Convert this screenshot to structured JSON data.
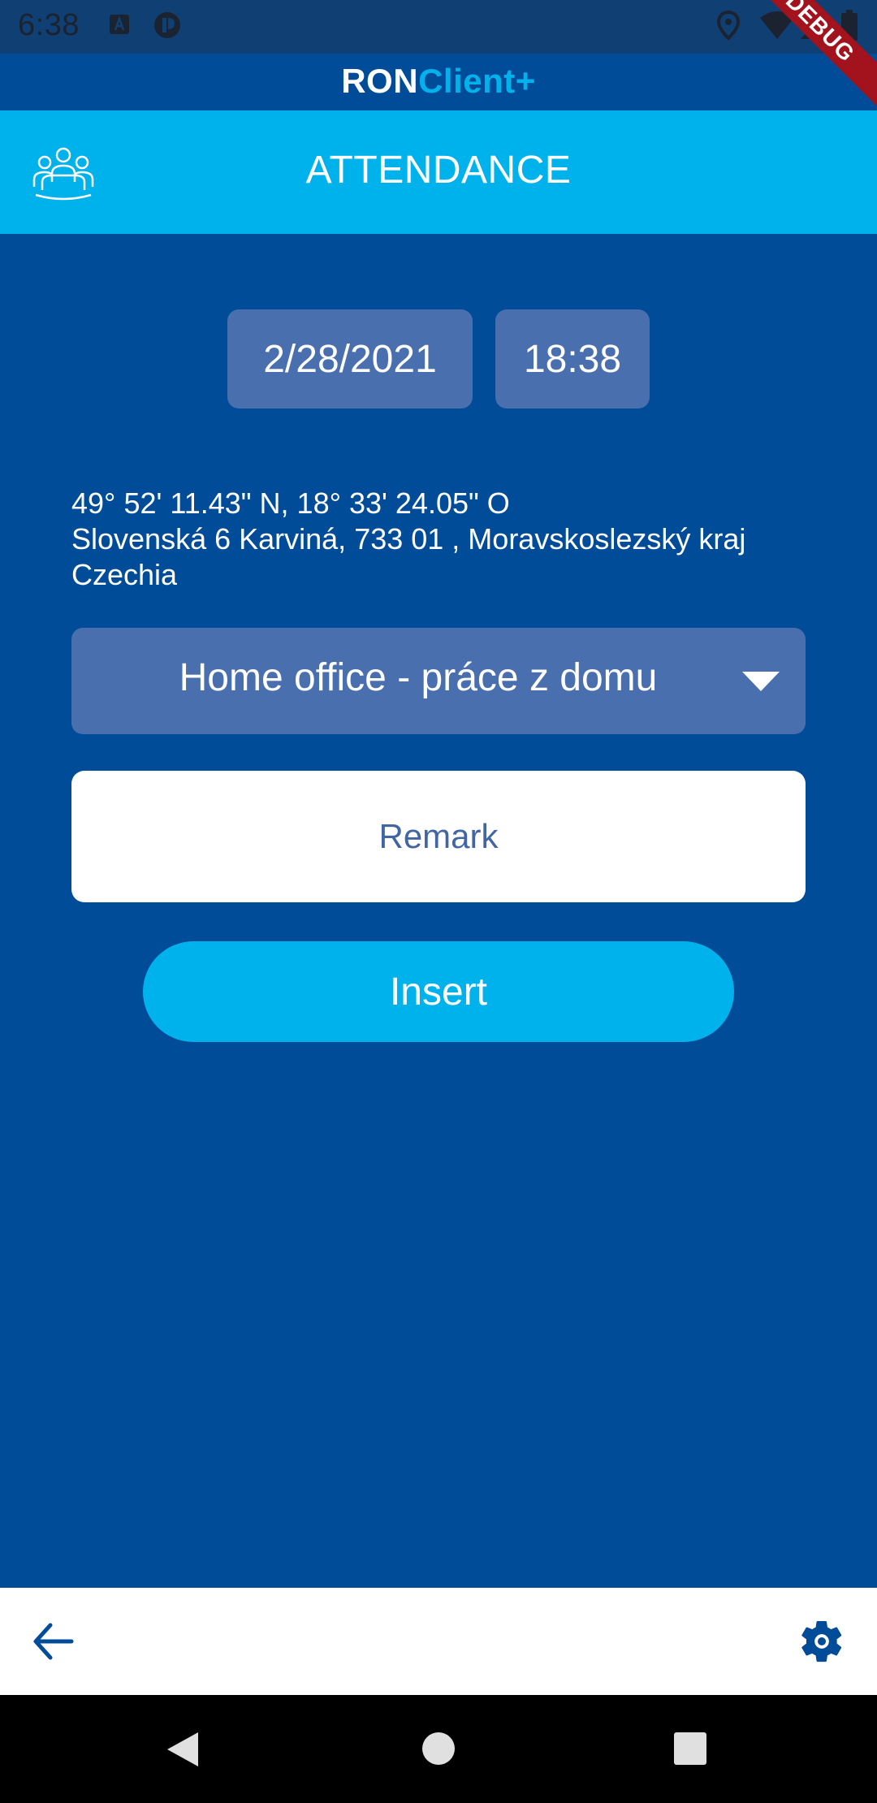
{
  "status_bar": {
    "time": "6:38",
    "icons": [
      "a-box-icon",
      "app-notification-icon",
      "location-icon",
      "wifi-icon",
      "cell-signal-icon",
      "battery-icon"
    ]
  },
  "app_bar": {
    "title_part1": "RON",
    "title_part2": "Client+",
    "accent_color": "#00b2ec"
  },
  "header": {
    "title": "ATTENDANCE",
    "icon": "team-icon",
    "color": "#00b2ec"
  },
  "form": {
    "date": "2/28/2021",
    "time": "18:38",
    "location": {
      "coordinates": "49° 52' 11.43\" N, 18° 33' 24.05\" O",
      "address": "Slovenská 6 Karviná, 733 01 , Moravskoslezský kraj",
      "country": "Czechia"
    },
    "attendance_type": {
      "selected": "Home office - práce z domu"
    },
    "remark": {
      "value": "",
      "placeholder": "Remark"
    },
    "insert_label": "Insert"
  },
  "bottom_bar": {
    "icons": [
      "back-arrow-icon",
      "gear-icon"
    ]
  },
  "debug_banner": "DEBUG",
  "colors": {
    "background": "#014c98",
    "panel": "#4a6fae",
    "accent": "#00b2ec"
  }
}
